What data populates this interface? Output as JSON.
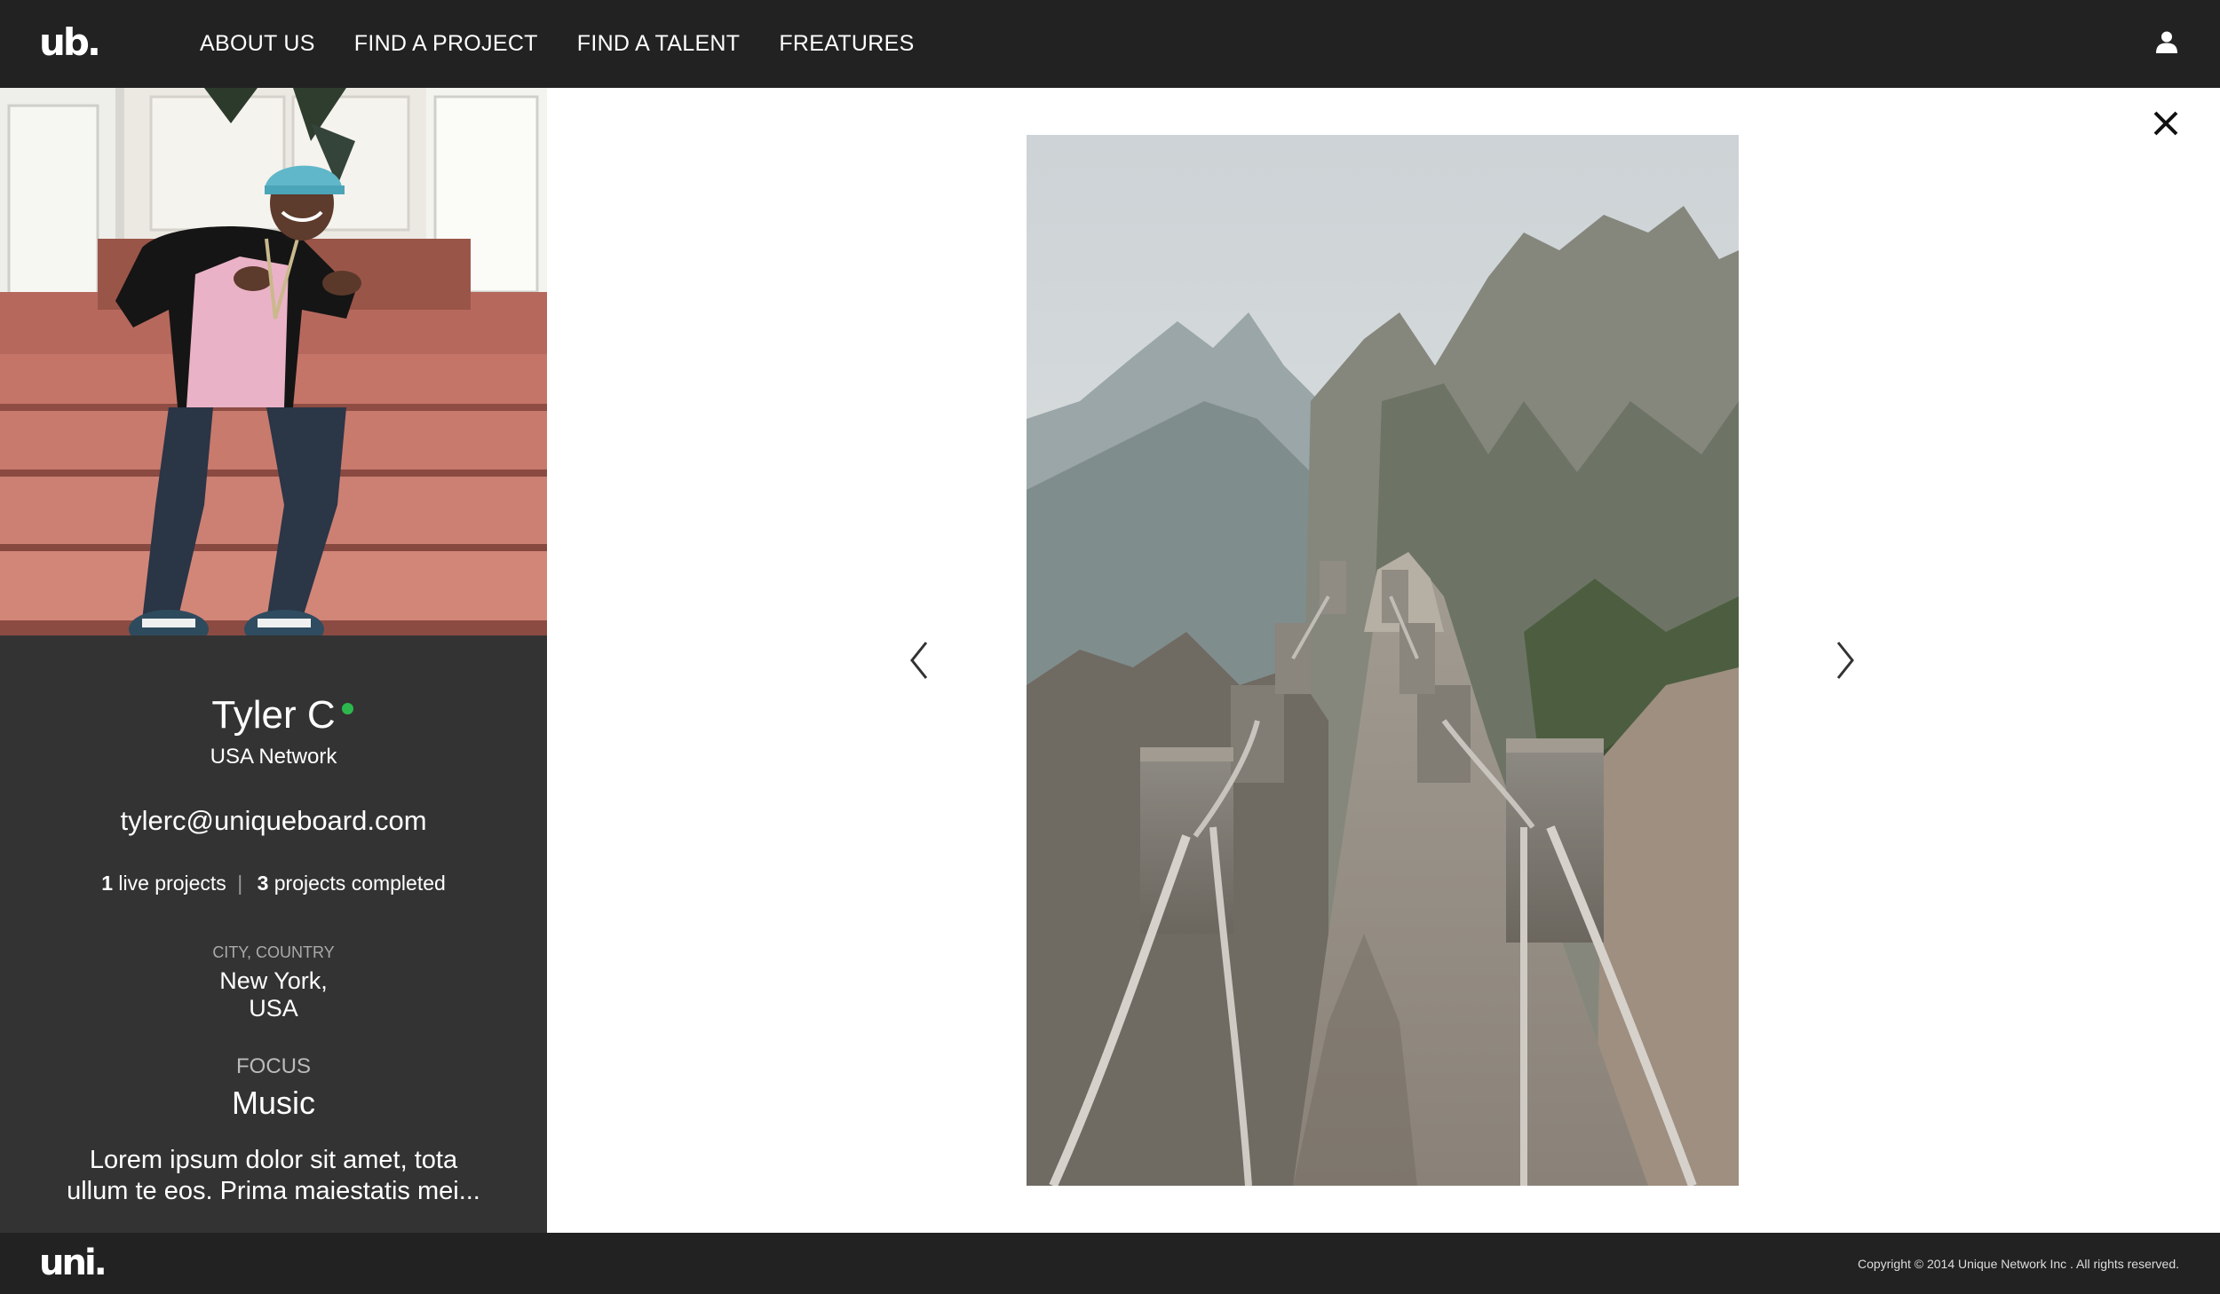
{
  "header": {
    "logo": "ub.",
    "nav": [
      {
        "label": "ABOUT US"
      },
      {
        "label": "FIND A PROJECT"
      },
      {
        "label": "FIND A TALENT"
      },
      {
        "label": "FREATURES"
      }
    ],
    "user_icon": "user-icon"
  },
  "profile": {
    "name": "Tyler C",
    "status": "online",
    "status_color": "#2db84d",
    "network": "USA Network",
    "email": "tylerc@uniqueboard.com",
    "stats": {
      "live_count": "1",
      "live_label": "live projects",
      "separator": "|",
      "completed_count": "3",
      "completed_label": "projects completed"
    },
    "location": {
      "label": "CITY, COUNTRY",
      "city": "New York,",
      "country": "USA"
    },
    "focus": {
      "label": "FOCUS",
      "value": "Music"
    },
    "bio_line1": "Lorem ipsum dolor sit amet, tota",
    "bio_line2": "ullum te eos. Prima maiestatis mei..."
  },
  "viewer": {
    "close_icon": "close-icon",
    "prev_icon": "chevron-left-icon",
    "next_icon": "chevron-right-icon"
  },
  "footer": {
    "logo": "uni.",
    "copyright": "Copyright © 2014 Unique Network Inc . All rights reserved."
  },
  "colors": {
    "nav_bg": "#222222",
    "profile_bg": "#333333",
    "viewer_bg": "#ffffff"
  }
}
